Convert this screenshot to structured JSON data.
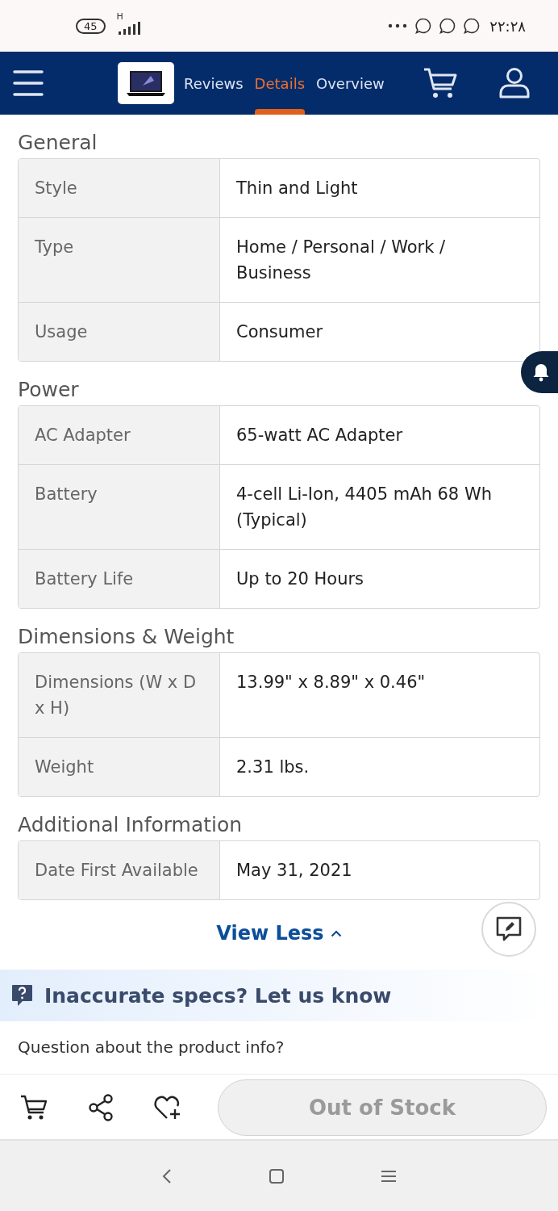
{
  "status_bar": {
    "battery": "45",
    "network": "H",
    "time": "۲۲:۲۸"
  },
  "nav": {
    "tabs": [
      {
        "label": "Reviews",
        "selected": false
      },
      {
        "label": "Details",
        "selected": true
      },
      {
        "label": "Overview",
        "selected": false
      }
    ]
  },
  "sections": [
    {
      "title": "General",
      "rows": [
        {
          "label": "Style",
          "value": "Thin and Light"
        },
        {
          "label": "Type",
          "value": "Home / Personal / Work / Business"
        },
        {
          "label": "Usage",
          "value": "Consumer"
        }
      ]
    },
    {
      "title": "Power",
      "rows": [
        {
          "label": "AC Adapter",
          "value": "65-watt AC Adapter"
        },
        {
          "label": "Battery",
          "value": "4-cell Li-Ion, 4405 mAh 68 Wh (Typical)"
        },
        {
          "label": "Battery Life",
          "value": "Up to 20 Hours"
        }
      ]
    },
    {
      "title": "Dimensions & Weight",
      "rows": [
        {
          "label": "Dimensions (W x D x H)",
          "value": "13.99\" x 8.89\" x 0.46\""
        },
        {
          "label": "Weight",
          "value": "2.31 lbs."
        }
      ]
    },
    {
      "title": "Additional Information",
      "rows": [
        {
          "label": "Date First Available",
          "value": "May 31, 2021"
        }
      ]
    }
  ],
  "view_less": "View Less",
  "feedback_banner": "Inaccurate specs? Let us know",
  "question": "Question about the product info?",
  "bottom_bar": {
    "stock_button": {
      "label": "Out of Stock",
      "disabled": true
    }
  }
}
